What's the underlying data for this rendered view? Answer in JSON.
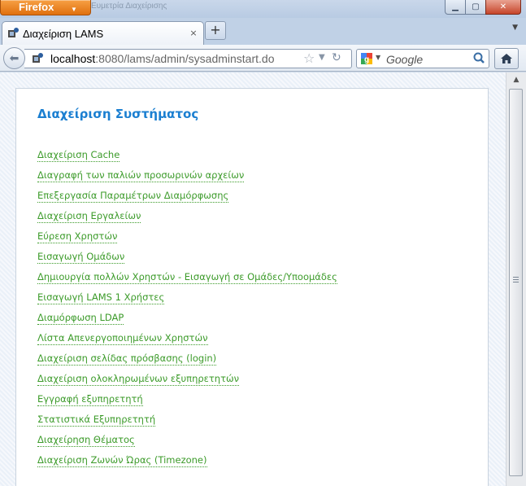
{
  "window": {
    "menu_button": "Firefox",
    "ghost_title": "Ευμετρία Διαχείρισης"
  },
  "tab": {
    "title": "Διαχείριση LAMS",
    "close": "×"
  },
  "new_tab": "+",
  "navbar": {
    "url_host": "localhost",
    "url_path": ":8080/lams/admin/sysadminstart.do",
    "search_placeholder": "Google"
  },
  "page": {
    "heading": "Διαχείριση Συστήματος",
    "links": [
      "Διαχείριση Cache",
      "Διαγραφή των παλιών προσωρινών αρχείων",
      "Επεξεργασία Παραμέτρων Διαμόρφωσης",
      "Διαχείριση Εργαλείων",
      "Εύρεση Χρηστών",
      "Εισαγωγή Ομάδων",
      "Δημιουργία πολλών Χρηστών - Εισαγωγή σε Ομάδες/Υποομάδες",
      "Εισαγωγή LAMS 1 Χρήστες",
      "Διαμόρφωση LDAP",
      "Λίστα Απενεργοποιημένων Χρηστών",
      "Διαχείριση σελίδας πρόσβασης (login)",
      "Διαχείριση ολοκληρωμένων εξυπηρετητών",
      "Εγγραφή εξυπηρετητή",
      "Στατιστικά Εξυπηρετητή",
      "Διαχείρηση Θέματος",
      "Διαχείριση Ζωνών Ώρας (Timezone)"
    ]
  },
  "colors": {
    "heading": "#1b7fd1",
    "link": "#3c9b2a",
    "firefox_orange": "#e0700e"
  },
  "icons": [
    "firefox-menu-arrow-icon",
    "favicon-icon",
    "back-arrow-icon",
    "bookmark-star-icon",
    "reload-icon",
    "google-logo-icon",
    "search-magnifier-icon",
    "home-icon",
    "scroll-up-arrow-icon"
  ]
}
